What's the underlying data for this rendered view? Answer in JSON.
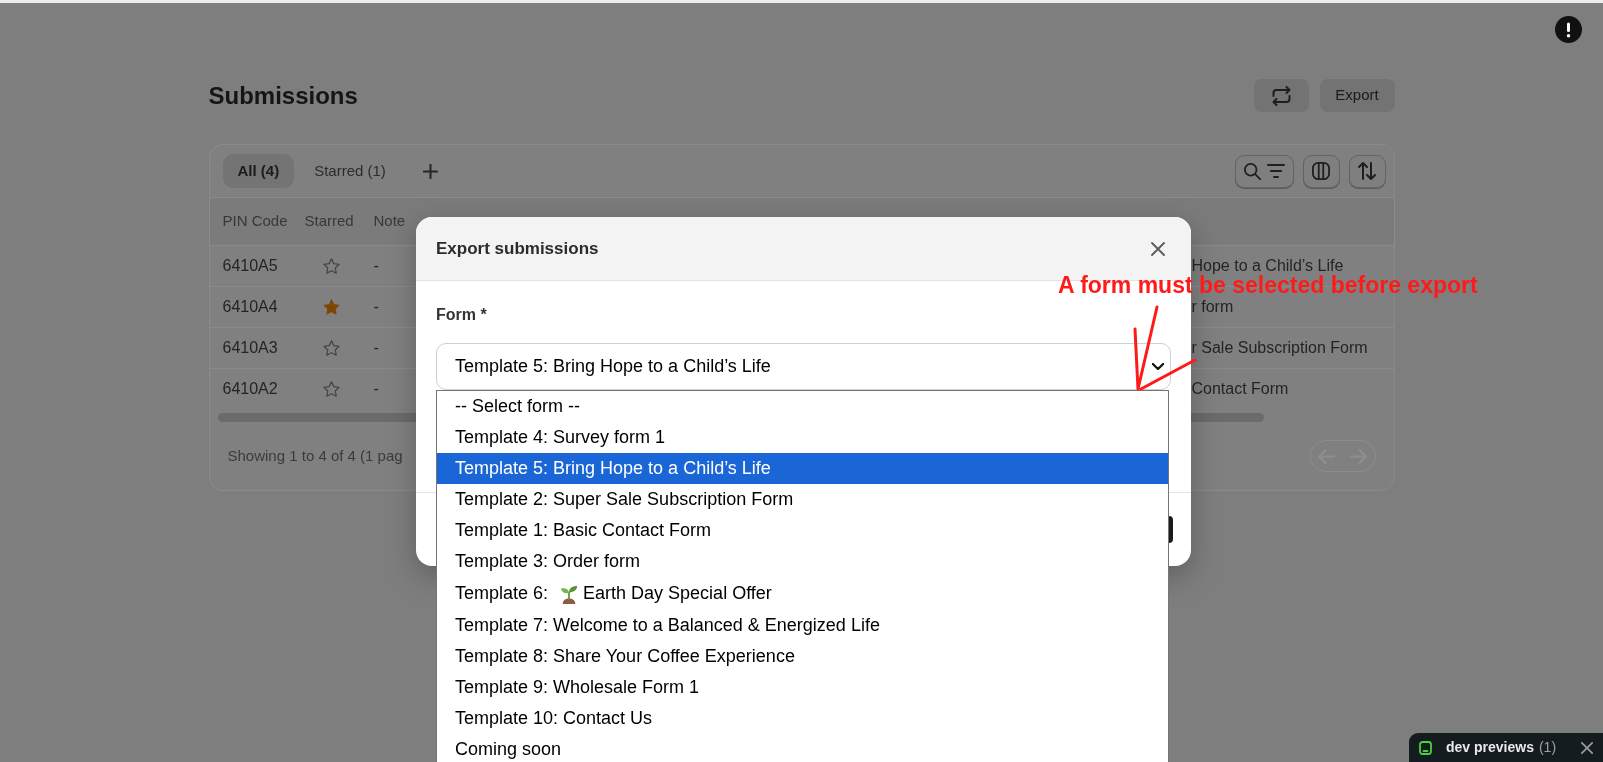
{
  "page": {
    "title": "Submissions",
    "export_label": "Export"
  },
  "tabs": [
    {
      "label": "All (4)",
      "selected": true
    },
    {
      "label": "Starred (1)",
      "selected": false
    }
  ],
  "table": {
    "columns": [
      "PIN Code",
      "Starred",
      "Note"
    ],
    "rows": [
      {
        "pin_code": "6410A5",
        "starred": false,
        "note": "-",
        "column_4": "Hope to a Child’s Life"
      },
      {
        "pin_code": "6410A4",
        "starred": true,
        "note": "-",
        "column_4": "r form"
      },
      {
        "pin_code": "6410A3",
        "starred": false,
        "note": "-",
        "column_4": "r Sale Subscription Form"
      },
      {
        "pin_code": "6410A2",
        "starred": false,
        "note": "-",
        "column_4": "Contact Form"
      }
    ]
  },
  "footer": {
    "summary": "Showing 1 to 4 of 4 (1 pag"
  },
  "pagination": [
    {
      "kind": "prev",
      "disabled": true
    },
    {
      "kind": "next",
      "disabled": true
    }
  ],
  "modal": {
    "title": "Export submissions",
    "field_label": "Form *",
    "select_value": "Template 5: Bring Hope to a Child’s Life",
    "options": [
      {
        "kind": "text",
        "label": "-- Select form --",
        "selected": false
      },
      {
        "kind": "text",
        "label": "Template 4: Survey form 1",
        "selected": false
      },
      {
        "kind": "text",
        "label": "Template 5: Bring Hope to a Child’s Life",
        "selected": true
      },
      {
        "kind": "text",
        "label": "Template 2: Super Sale Subscription Form",
        "selected": false
      },
      {
        "kind": "text",
        "label": "Template 1: Basic Contact Form",
        "selected": false
      },
      {
        "kind": "text",
        "label": "Template 3: Order form",
        "selected": false
      },
      {
        "kind": "emoji",
        "label": "Template 6:",
        "label_after": "Earth Day Special Offer",
        "selected": false
      },
      {
        "kind": "text",
        "label": "Template 7: Welcome to a Balanced & Energized Life",
        "selected": false
      },
      {
        "kind": "text",
        "label": "Template 8: Share Your Coffee Experience",
        "selected": false
      },
      {
        "kind": "text",
        "label": "Template 9: Wholesale Form 1",
        "selected": false
      },
      {
        "kind": "text",
        "label": "Template 10: Contact Us",
        "selected": false
      },
      {
        "kind": "text",
        "label": "Coming soon",
        "selected": false
      }
    ]
  },
  "annotation": {
    "text": "A form must be selected before export"
  },
  "dev_previews": {
    "label": "dev previews",
    "count": "(1)"
  }
}
